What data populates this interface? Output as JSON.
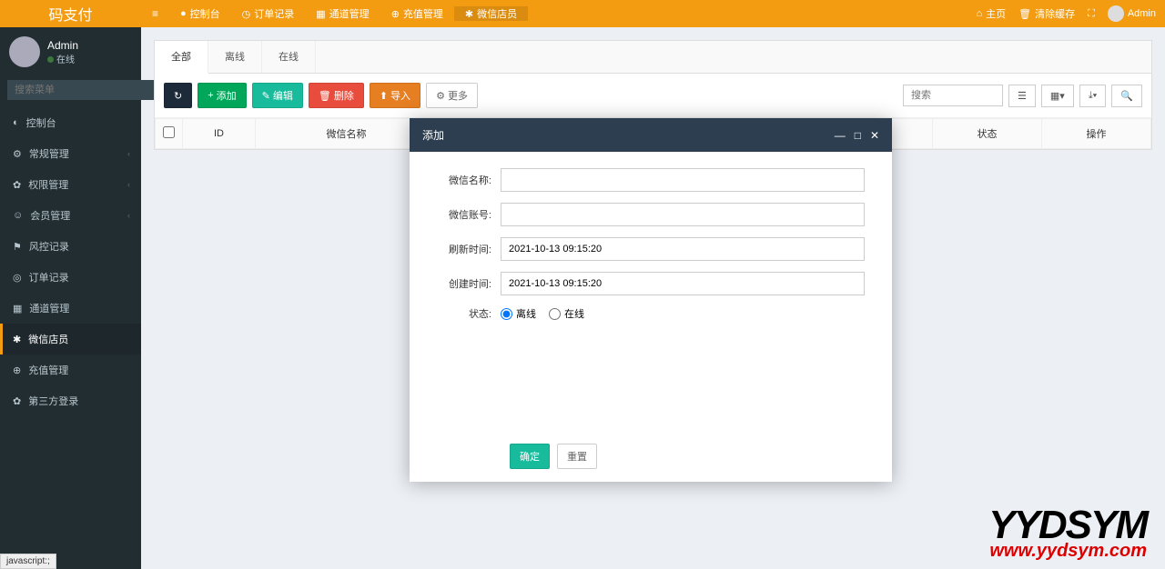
{
  "brand": "码支付",
  "user": {
    "name": "Admin",
    "status": "在线"
  },
  "header_nav": [
    {
      "icon": "●",
      "label": "控制台"
    },
    {
      "icon": "◷",
      "label": "订单记录"
    },
    {
      "icon": "▦",
      "label": "通道管理"
    },
    {
      "icon": "⊕",
      "label": "充值管理"
    },
    {
      "icon": "✱",
      "label": "微信店员"
    }
  ],
  "header_right": {
    "home": "主页",
    "clear": "清除缓存",
    "admin": "Admin"
  },
  "sidebar_search_placeholder": "搜索菜单",
  "sidebar_menu": [
    {
      "icon": "◐",
      "label": "控制台"
    },
    {
      "icon": "⚙",
      "label": "常规管理",
      "expandable": true
    },
    {
      "icon": "✿",
      "label": "权限管理",
      "expandable": true
    },
    {
      "icon": "☺",
      "label": "会员管理",
      "expandable": true
    },
    {
      "icon": "⚑",
      "label": "风控记录"
    },
    {
      "icon": "◎",
      "label": "订单记录"
    },
    {
      "icon": "▦",
      "label": "通道管理"
    },
    {
      "icon": "✱",
      "label": "微信店员",
      "active": true
    },
    {
      "icon": "⊕",
      "label": "充值管理"
    },
    {
      "icon": "✿",
      "label": "第三方登录"
    }
  ],
  "tabs": [
    {
      "label": "全部",
      "active": true
    },
    {
      "label": "离线"
    },
    {
      "label": "在线"
    }
  ],
  "toolbar": {
    "refresh": "↻",
    "add": "添加",
    "edit": "编辑",
    "delete": "删除",
    "import": "导入",
    "more": "更多",
    "search_placeholder": "搜索"
  },
  "table_headers": {
    "id": "ID",
    "wxname": "微信名称",
    "status": "状态",
    "action": "操作"
  },
  "modal": {
    "title": "添加",
    "fields": {
      "wxname": "微信名称:",
      "wxaccount": "微信账号:",
      "refresh_time": "刷新时间:",
      "create_time": "创建时间:",
      "status": "状态:"
    },
    "values": {
      "refresh_time": "2021-10-13 09:15:20",
      "create_time": "2021-10-13 09:15:20"
    },
    "radio": {
      "offline": "离线",
      "online": "在线"
    },
    "submit": "确定",
    "reset": "重置"
  },
  "watermark": {
    "line1": "YYDSYM",
    "line2": "www.yydsym.com"
  },
  "status_text": "javascript:;"
}
